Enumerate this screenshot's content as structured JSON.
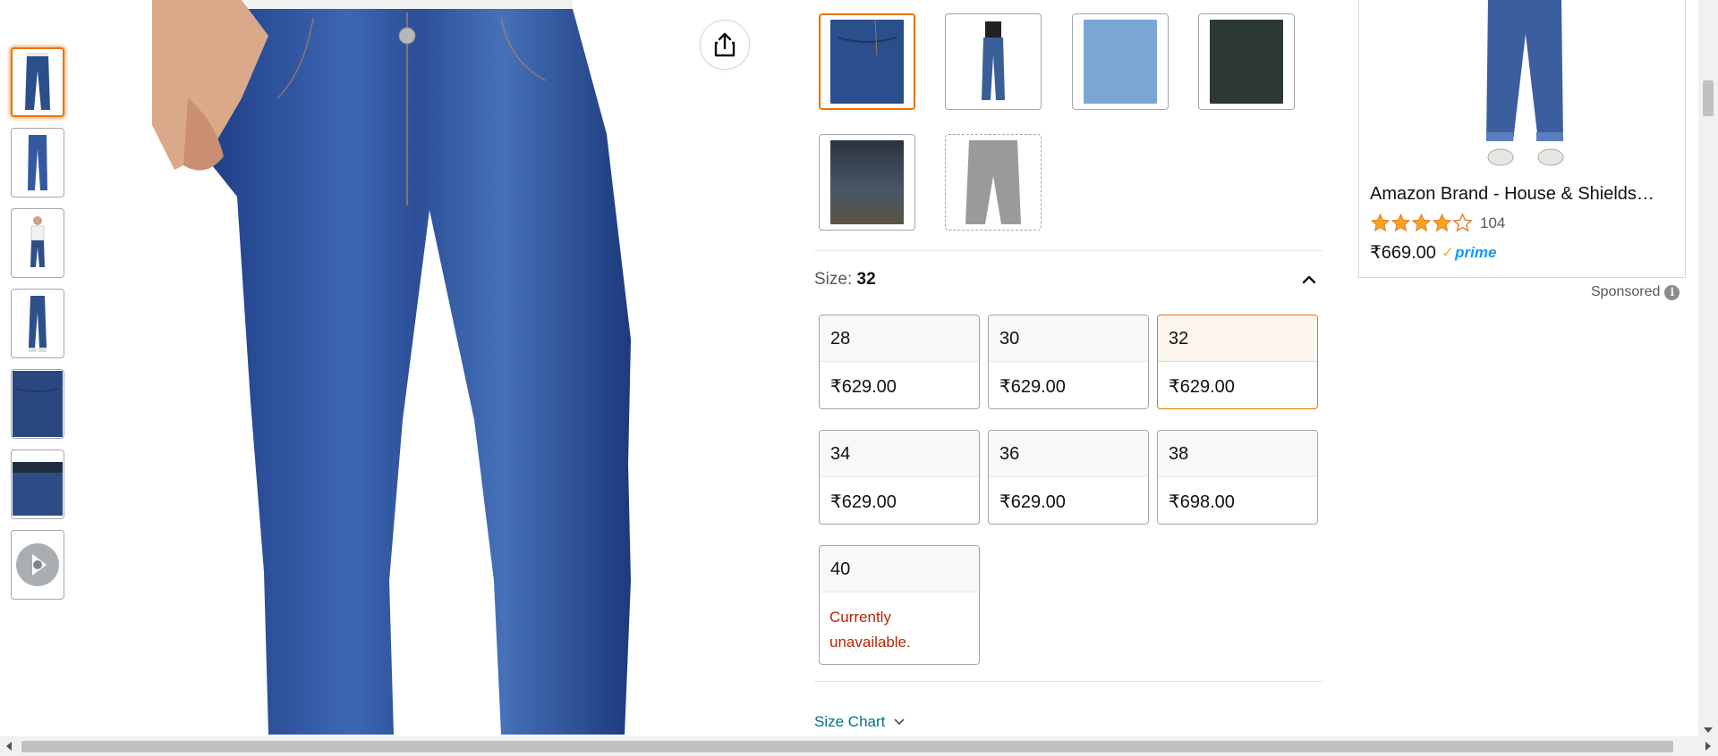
{
  "gallery": {
    "thumbnails": [
      {
        "alt": "jeans-front",
        "selected": true
      },
      {
        "alt": "jeans-full-front"
      },
      {
        "alt": "model-full-body"
      },
      {
        "alt": "jeans-side"
      },
      {
        "alt": "jeans-pocket-detail"
      },
      {
        "alt": "jeans-waist-detail"
      },
      {
        "alt": "video-360"
      }
    ]
  },
  "colors": {
    "swatches": [
      {
        "name": "dark-blue",
        "color": "#2b4f8c",
        "selected": true
      },
      {
        "name": "model-blue",
        "color": "#3a5f98"
      },
      {
        "name": "light-blue",
        "color": "#7aa6d6"
      },
      {
        "name": "dark-green-black",
        "color": "#2c3834"
      },
      {
        "name": "black-tint",
        "color": "#3a4652"
      },
      {
        "name": "grey",
        "color": "#9a9a9a",
        "unavailable": true
      }
    ]
  },
  "size": {
    "label": "Size:",
    "selected": "32",
    "options": [
      {
        "size": "28",
        "price": "₹629.00"
      },
      {
        "size": "30",
        "price": "₹629.00"
      },
      {
        "size": "32",
        "price": "₹629.00",
        "selected": true
      },
      {
        "size": "34",
        "price": "₹629.00"
      },
      {
        "size": "36",
        "price": "₹629.00"
      },
      {
        "size": "38",
        "price": "₹698.00"
      },
      {
        "size": "40",
        "status_line1": "Currently",
        "status_line2": "unavailable."
      }
    ],
    "chart_link": "Size Chart"
  },
  "ad": {
    "title": "Amazon Brand - House & Shields…",
    "rating": 4,
    "review_count": "104",
    "price": "₹669.00",
    "prime_label": "prime",
    "sponsored_label": "Sponsored",
    "info_glyph": "i"
  },
  "colors_theme": {
    "accent": "#e77600",
    "link": "#007185",
    "unavailable": "#b12704",
    "prime": "#1399ff",
    "star": "#ffa41c"
  }
}
